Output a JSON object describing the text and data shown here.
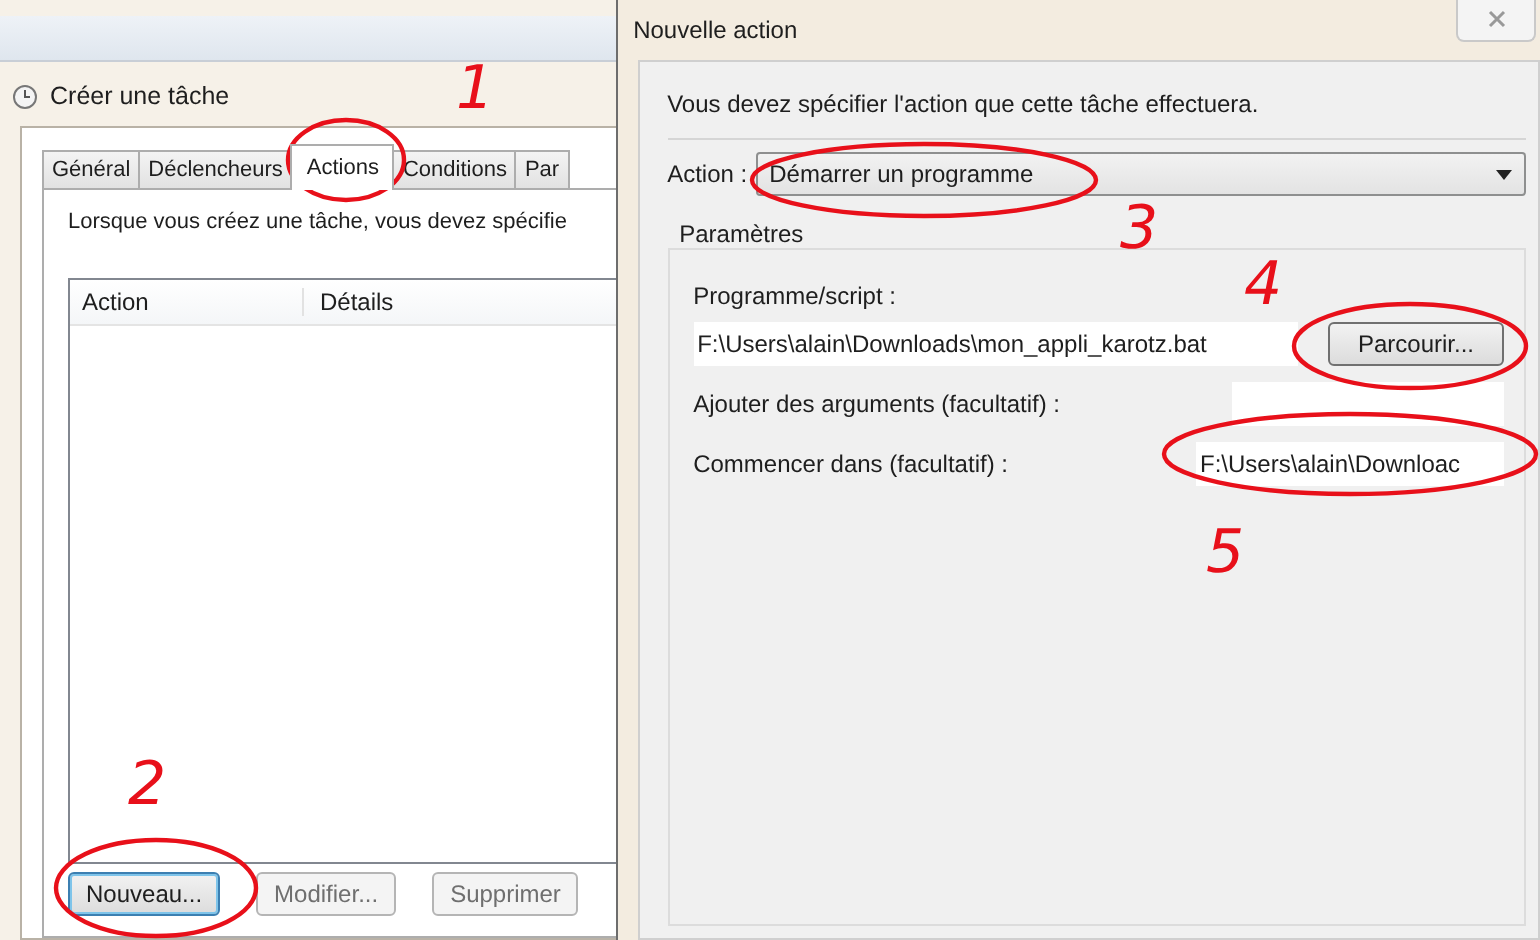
{
  "left_window": {
    "title": "Créer une tâche",
    "tabs": [
      {
        "label": "Général",
        "selected": false
      },
      {
        "label": "Déclencheurs",
        "selected": false
      },
      {
        "label": "Actions",
        "selected": true
      },
      {
        "label": "Conditions",
        "selected": false
      },
      {
        "label": "Par",
        "selected": false
      }
    ],
    "intro": "Lorsque vous créez une tâche, vous devez spécifie",
    "table": {
      "columns": [
        "Action",
        "Détails"
      ]
    },
    "buttons": [
      {
        "label": "Nouveau...",
        "disabled": false,
        "focused": true
      },
      {
        "label": "Modifier...",
        "disabled": true,
        "focused": false
      },
      {
        "label": "Supprimer",
        "disabled": true,
        "focused": false
      }
    ]
  },
  "right_window": {
    "title": "Nouvelle action",
    "intro": "Vous devez spécifier l'action que cette tâche effectuera.",
    "action": {
      "label": "Action :",
      "value": "Démarrer un programme"
    },
    "group": {
      "title": "Paramètres",
      "program": {
        "label": "Programme/script :",
        "value": "F:\\Users\\alain\\Downloads\\mon_appli_karotz.bat",
        "button": "Parcourir..."
      },
      "arguments": {
        "label": "Ajouter des arguments (facultatif) :"
      },
      "start_in": {
        "label": "Commencer dans (facultatif) :",
        "value": "F:\\Users\\alain\\Downloac"
      }
    }
  },
  "annotations": [
    {
      "number": "1"
    },
    {
      "number": "2"
    },
    {
      "number": "3"
    },
    {
      "number": "4"
    },
    {
      "number": "5"
    }
  ]
}
